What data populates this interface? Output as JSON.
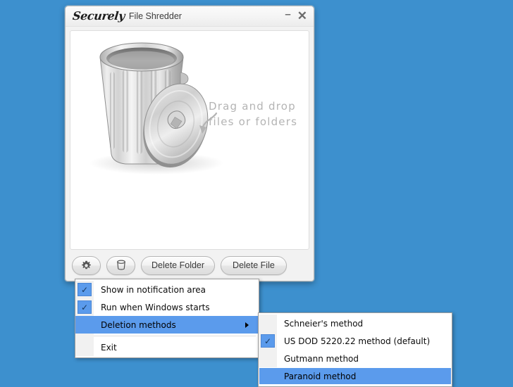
{
  "desktop": {
    "background_color": "#3d90ce"
  },
  "window": {
    "brand": "Securely",
    "app_name": "File Shredder",
    "minimize_label": "–",
    "close_label": "✕",
    "drop_zone": {
      "hint_line1": "Drag and drop",
      "hint_line2": "files or folders",
      "illustration": "trash-can-illustration"
    },
    "toolbar": {
      "settings_icon": "gear-icon",
      "empty_bin_icon": "trash-bin-icon",
      "delete_folder_label": "Delete Folder",
      "delete_file_label": "Delete File"
    }
  },
  "context_menu": {
    "items": [
      {
        "label": "Show in notification area",
        "checked": true,
        "highlighted": false,
        "has_submenu": false
      },
      {
        "label": "Run when Windows starts",
        "checked": true,
        "highlighted": false,
        "has_submenu": false
      },
      {
        "label": "Deletion methods",
        "checked": false,
        "highlighted": true,
        "has_submenu": true
      },
      {
        "label": "Exit",
        "checked": false,
        "highlighted": false,
        "has_submenu": false
      }
    ]
  },
  "submenu": {
    "items": [
      {
        "label": "Schneier's method",
        "checked": false,
        "highlighted": false
      },
      {
        "label": "US DOD 5220.22 method (default)",
        "checked": true,
        "highlighted": false
      },
      {
        "label": "Gutmann method",
        "checked": false,
        "highlighted": false
      },
      {
        "label": "Paranoid method",
        "checked": false,
        "highlighted": true
      }
    ]
  },
  "colors": {
    "desktop_blue": "#3d90ce",
    "menu_highlight": "#5b9bec",
    "check_blue": "#5b9bec"
  }
}
